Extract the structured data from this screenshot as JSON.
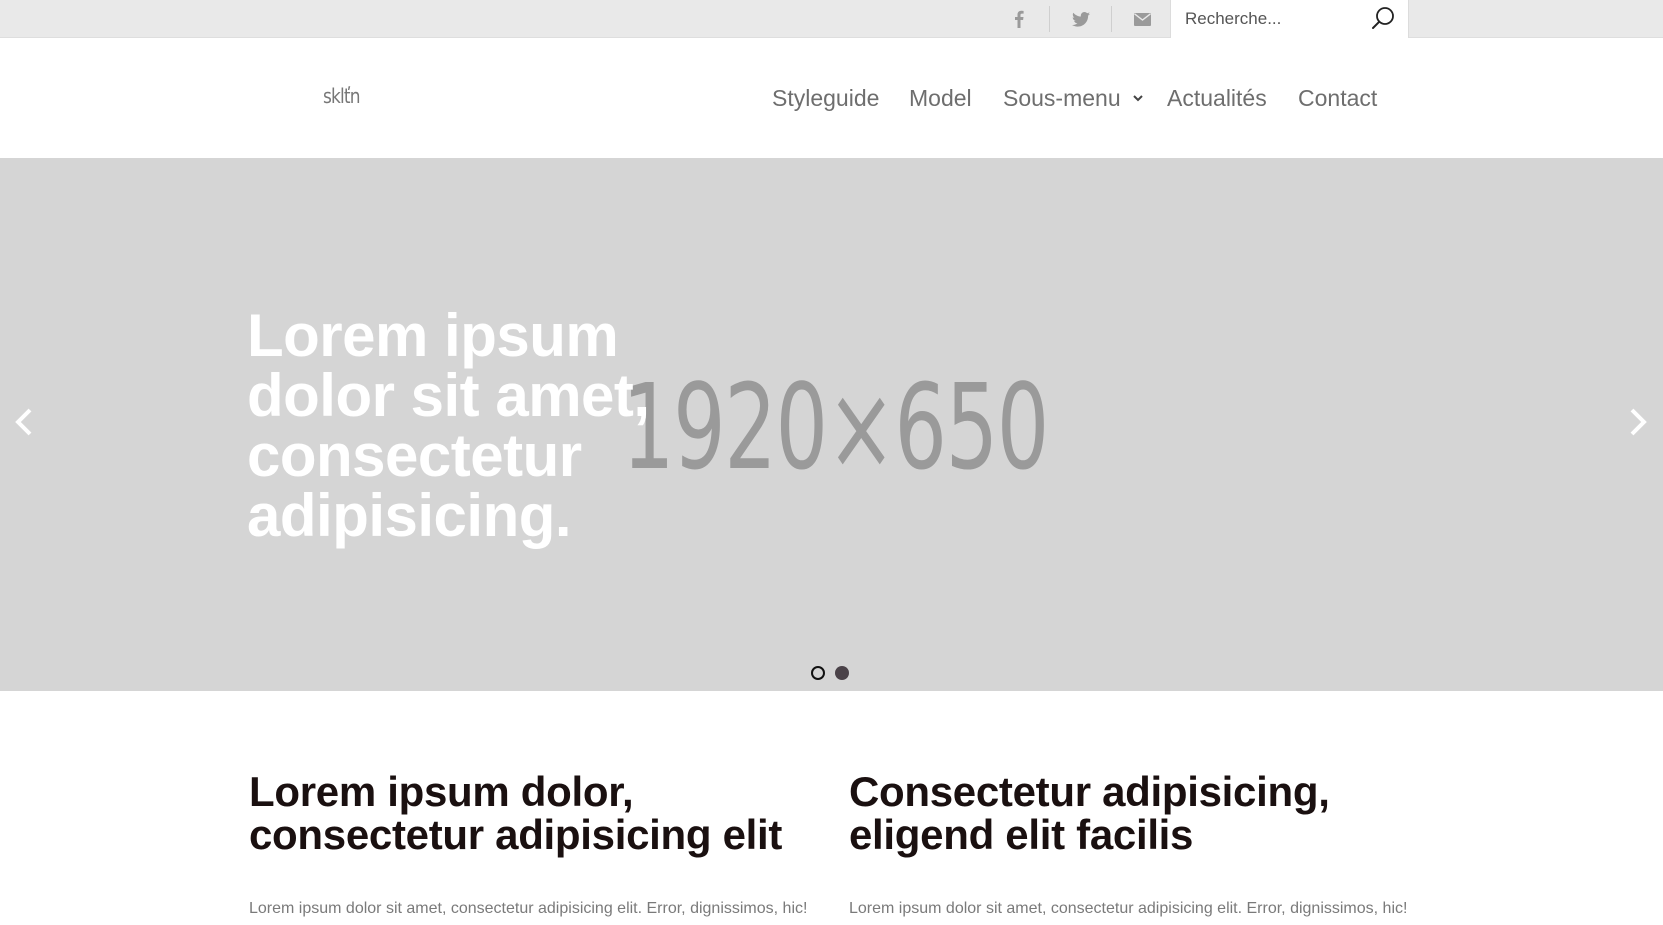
{
  "topbar": {
    "social": [
      {
        "name": "facebook-icon"
      },
      {
        "name": "twitter-icon"
      },
      {
        "name": "email-icon"
      }
    ],
    "search": {
      "placeholder": "Recherche..."
    }
  },
  "header": {
    "logo": "sklťn",
    "nav": [
      "Styleguide",
      "Model",
      "Sous-menu",
      "Actualités",
      "Contact"
    ]
  },
  "hero": {
    "placeholder_label": "1920×650",
    "title": "Lorem ipsum dolor sit amet, consectetur adipisicing.",
    "slides": 2,
    "active_slide": 2,
    "background": "#d5d5d5"
  },
  "content": {
    "columns": [
      {
        "heading": "Lorem ipsum dolor, consectetur adipisicing elit",
        "text": "Lorem ipsum dolor sit amet, consectetur adipisicing elit. Error, dignissimos, hic!"
      },
      {
        "heading": "Consectetur adipisicing, eligend elit facilis",
        "text": "Lorem ipsum dolor sit amet, consectetur adipisicing elit. Error, dignissimos, hic!"
      }
    ]
  }
}
